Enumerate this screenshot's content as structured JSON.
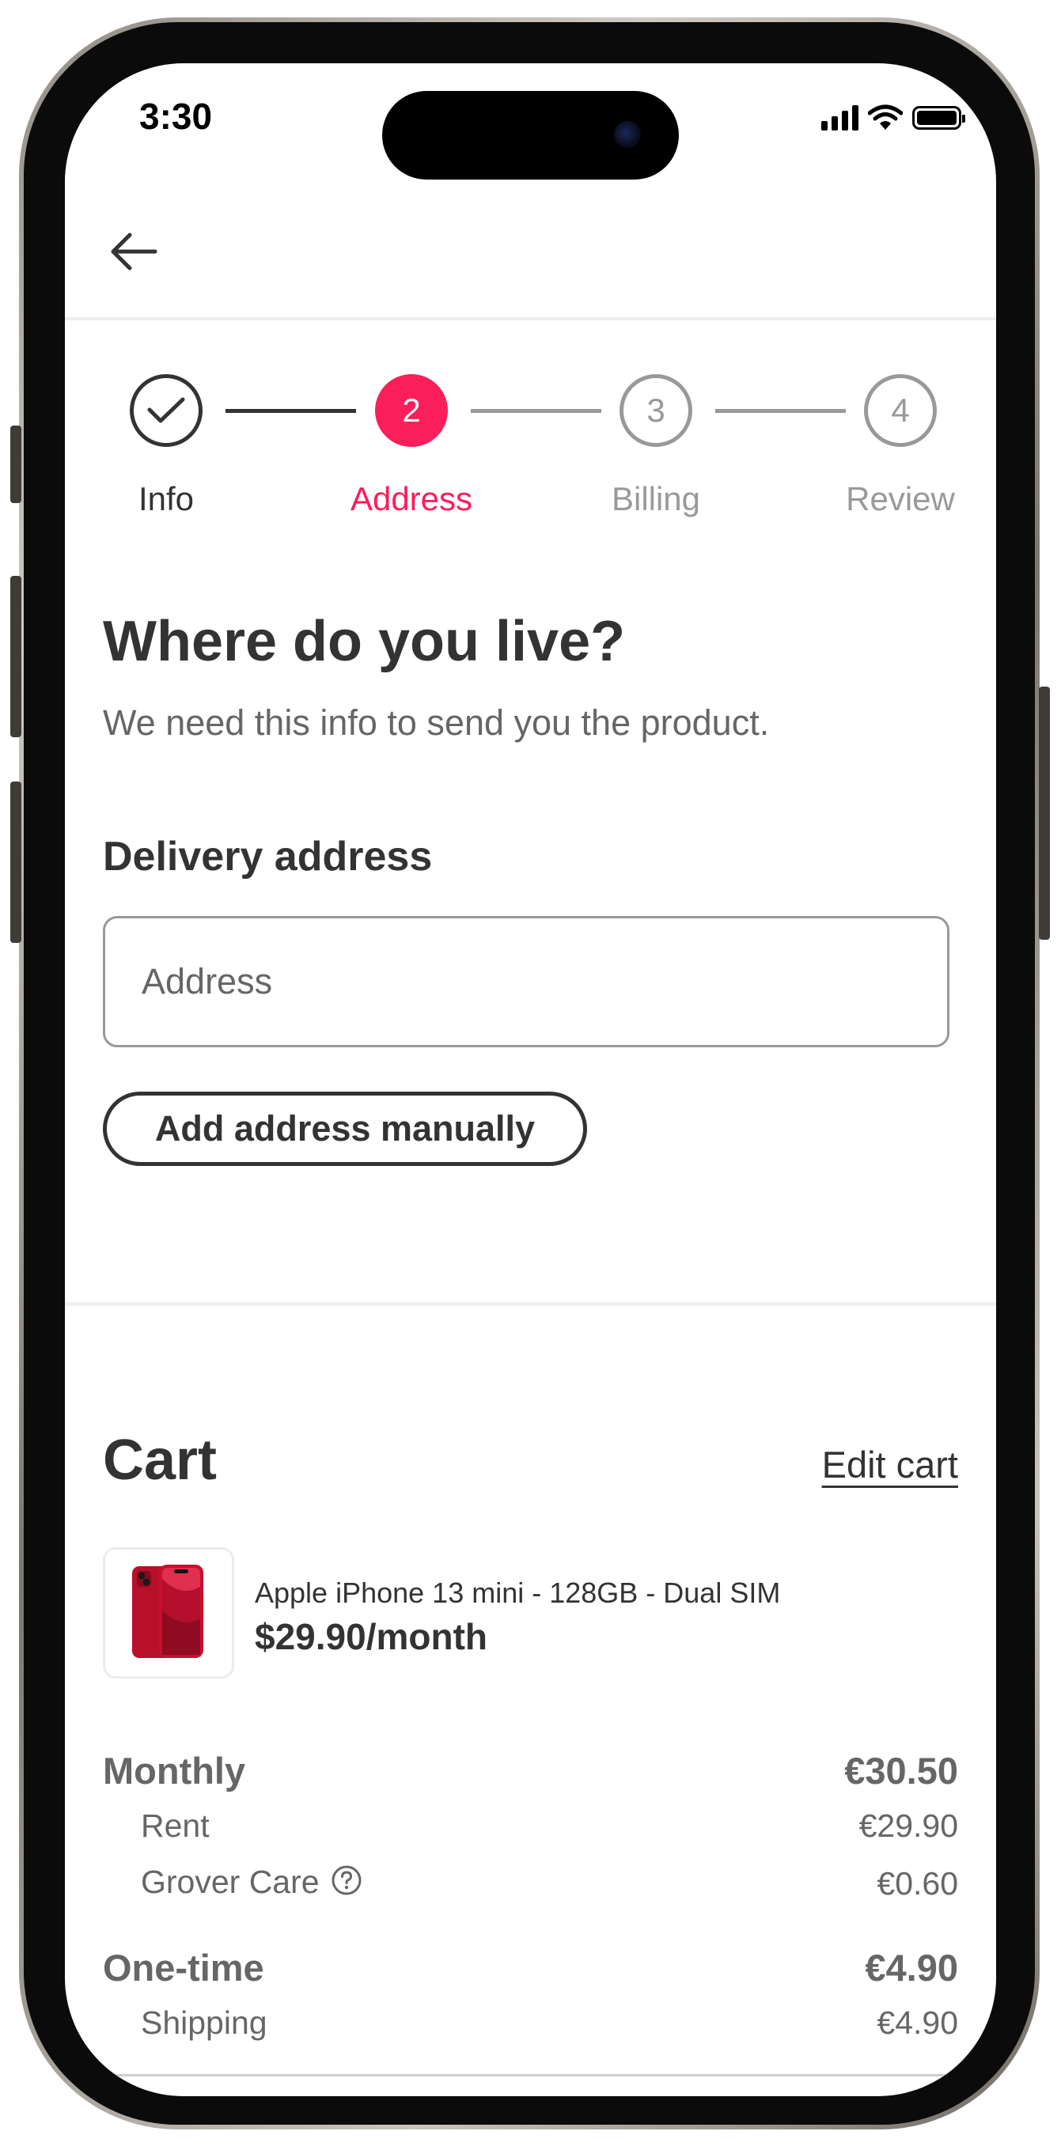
{
  "status_bar": {
    "time": "3:30"
  },
  "stepper": {
    "steps": [
      {
        "number": "",
        "label": "Info",
        "state": "completed"
      },
      {
        "number": "2",
        "label": "Address",
        "state": "active"
      },
      {
        "number": "3",
        "label": "Billing",
        "state": "upcoming"
      },
      {
        "number": "4",
        "label": "Review",
        "state": "upcoming"
      }
    ]
  },
  "main": {
    "title": "Where do you live?",
    "subtitle": "We need this info to send you the product.",
    "delivery_label": "Delivery address",
    "address_value": "",
    "address_placeholder": "Address",
    "manual_button_label": "Add address manually"
  },
  "cart": {
    "title": "Cart",
    "edit_label": "Edit cart",
    "product": {
      "name": "Apple iPhone 13 mini - 128GB - Dual SIM",
      "price": "$29.90/month"
    },
    "monthly": {
      "label": "Monthly",
      "total": "€30.50",
      "items": [
        {
          "label": "Rent",
          "value": "€29.90"
        },
        {
          "label": "Grover Care",
          "value": "€0.60"
        }
      ]
    },
    "one_time": {
      "label": "One-time",
      "total": "€4.90",
      "items": [
        {
          "label": "Shipping",
          "value": "€4.90"
        }
      ]
    }
  },
  "colors": {
    "accent": "#FA1E5A",
    "text_primary": "#333333",
    "text_secondary": "#666666",
    "muted": "#999999"
  },
  "icons": {
    "back": "arrow-left-icon",
    "completed_step": "checkmark-icon",
    "help": "question-circle-icon",
    "wifi": "wifi-icon",
    "battery": "battery-icon",
    "signal": "cellular-signal-icon"
  }
}
